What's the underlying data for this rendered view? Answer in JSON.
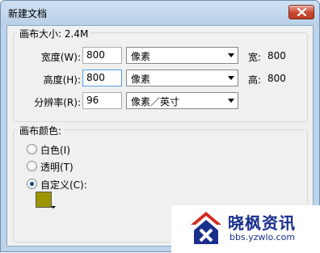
{
  "window": {
    "title": "新建文档"
  },
  "canvas_size": {
    "legend": "画布大小: 2.4M",
    "width_label": "宽度(W):",
    "width_value": "800",
    "width_unit": "像素",
    "width_readout_label": "宽:",
    "width_readout_value": "800",
    "height_label": "高度(H):",
    "height_value": "800",
    "height_unit": "像素",
    "height_readout_label": "高:",
    "height_readout_value": "800",
    "resolution_label": "分辨率(R):",
    "resolution_value": "96",
    "resolution_unit": "像素／英寸"
  },
  "canvas_color": {
    "legend": "画布颜色:",
    "options": [
      {
        "label": "白色(I)",
        "checked": false
      },
      {
        "label": "透明(T)",
        "checked": false
      },
      {
        "label": "自定义(C):",
        "checked": true
      }
    ],
    "custom_color": "#9c9500"
  },
  "watermark": {
    "title": "晓枫资讯",
    "subtitle": "bbs.yzwlo.com"
  },
  "colors": {
    "titlebar": "#bcd3ea",
    "close_button": "#c8482f",
    "watermark_blue": "#1a2f8c",
    "watermark_red": "#d42a1f"
  }
}
